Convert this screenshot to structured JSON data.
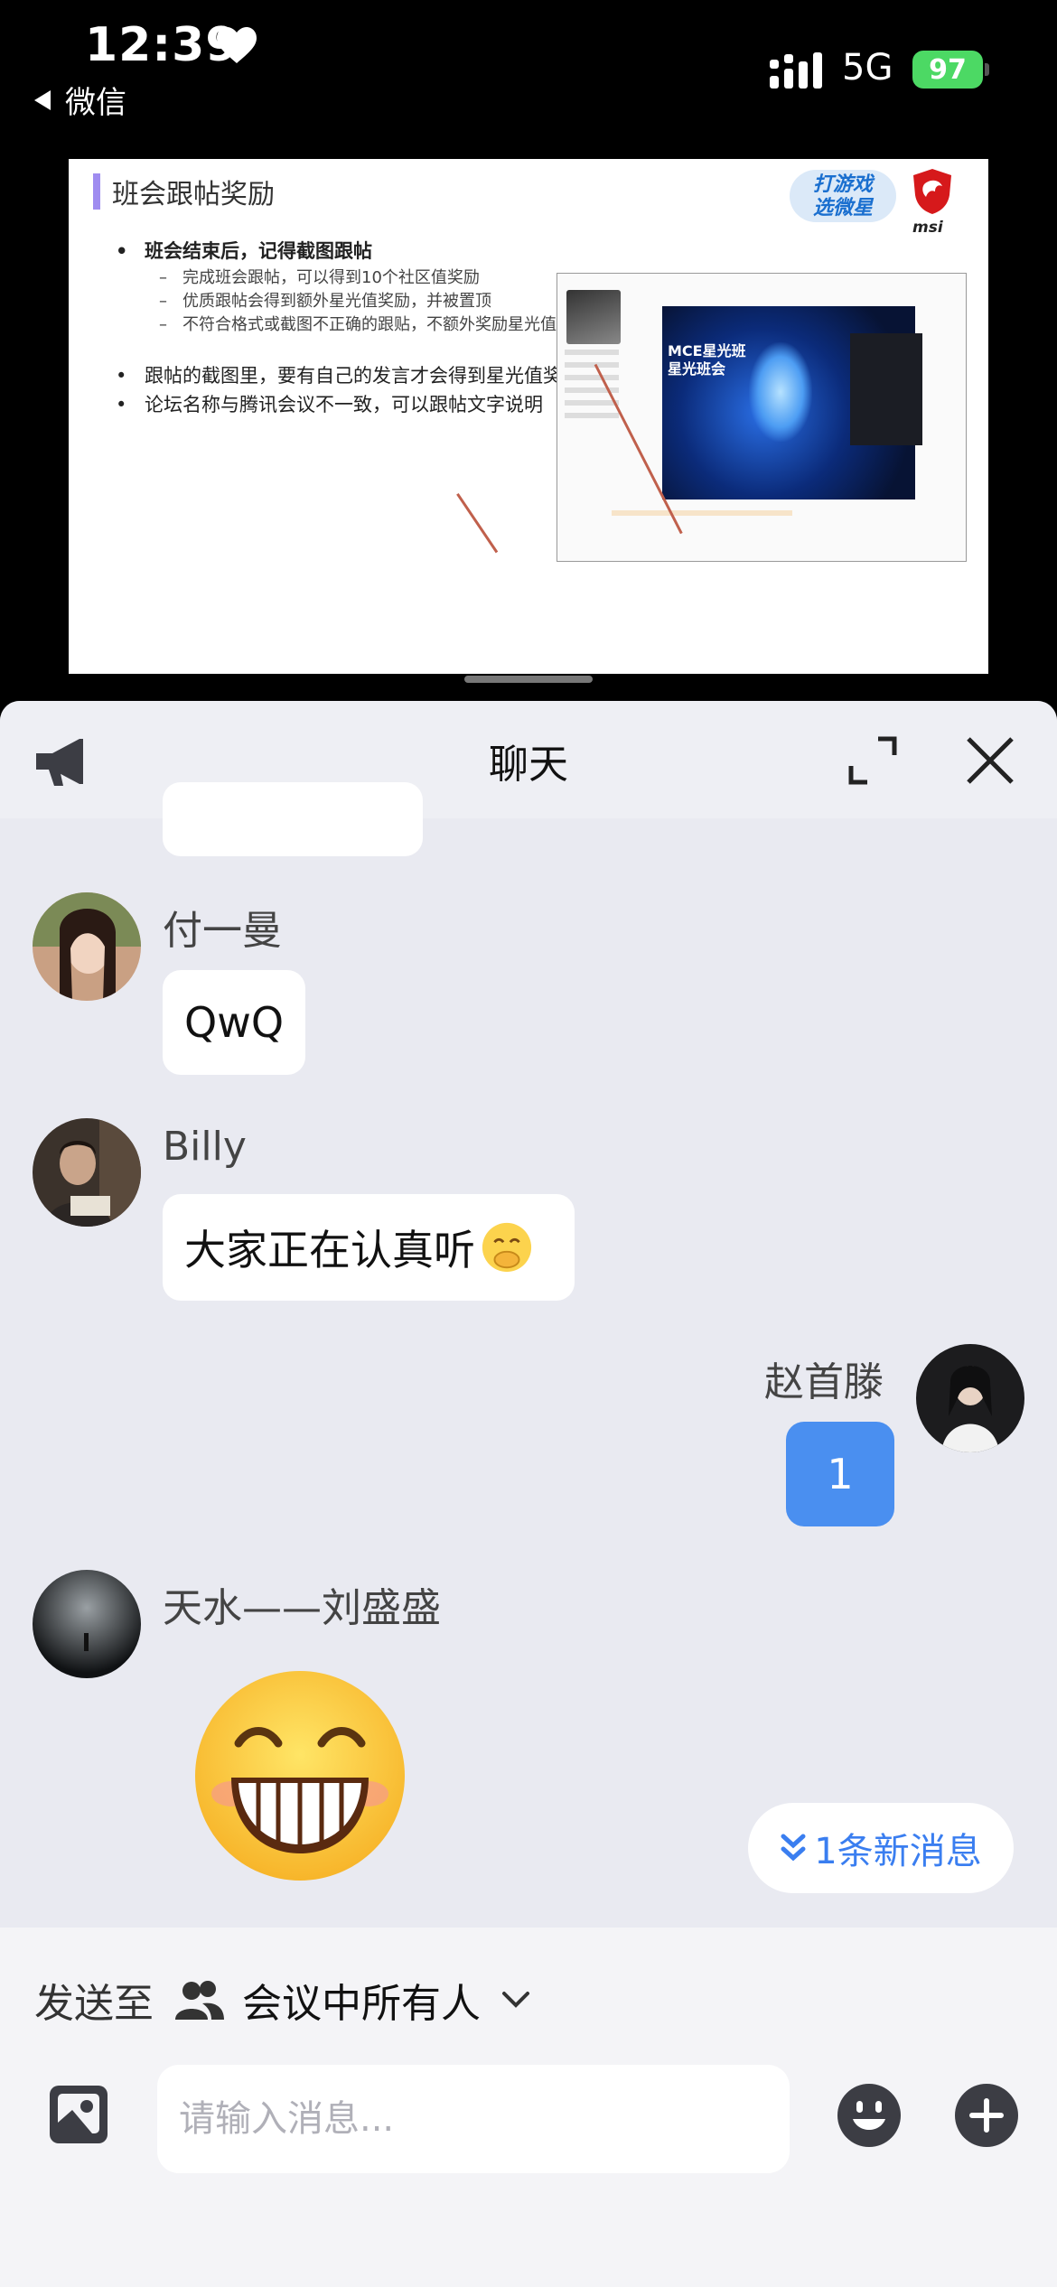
{
  "status_bar": {
    "time": "12:39",
    "back_app": "微信",
    "network": "5G",
    "battery": "97"
  },
  "slide": {
    "title": "班会跟帖奖励",
    "logo_text_top": "打游戏",
    "logo_text_bottom": "选微星",
    "logo_brand": "msi",
    "bullets": [
      {
        "text": "班会结束后，记得截图跟帖",
        "bold": true
      },
      {
        "text": "完成班会跟帖，可以得到10个社区值奖励",
        "sub": true
      },
      {
        "text": "优质跟帖会得到额外星光值奖励，并被置顶",
        "sub": true
      },
      {
        "text": "不符合格式或截图不正确的跟贴，不额外奖励星光值",
        "sub": true
      },
      {
        "text": "跟帖的截图里，要有自己的发言才会得到星光值奖励噢"
      },
      {
        "text": "论坛名称与腾讯会议不一致，可以跟帖文字说明"
      }
    ],
    "screenshot_video_text": "MCE星光班\n星光班会"
  },
  "chat": {
    "title": "聊天",
    "messages": [
      {
        "sender": "付一曼",
        "text": "QwQ",
        "side": "left"
      },
      {
        "sender": "Billy",
        "text": "大家正在认真听",
        "side": "left"
      },
      {
        "sender": "赵首滕",
        "text": "1",
        "side": "right"
      },
      {
        "sender": "天水——刘盛盛",
        "text": "",
        "side": "left",
        "emoji": "grinning-face"
      }
    ],
    "new_messages": "1条新消息"
  },
  "composer": {
    "send_to_label": "发送至",
    "send_to_target": "会议中所有人",
    "placeholder": "请输入消息..."
  },
  "colors": {
    "sheet_bg": "#e9eaf1",
    "my_bubble": "#4a8ff0",
    "accent_blue": "#3a7ef0",
    "battery_green": "#4cd964"
  }
}
